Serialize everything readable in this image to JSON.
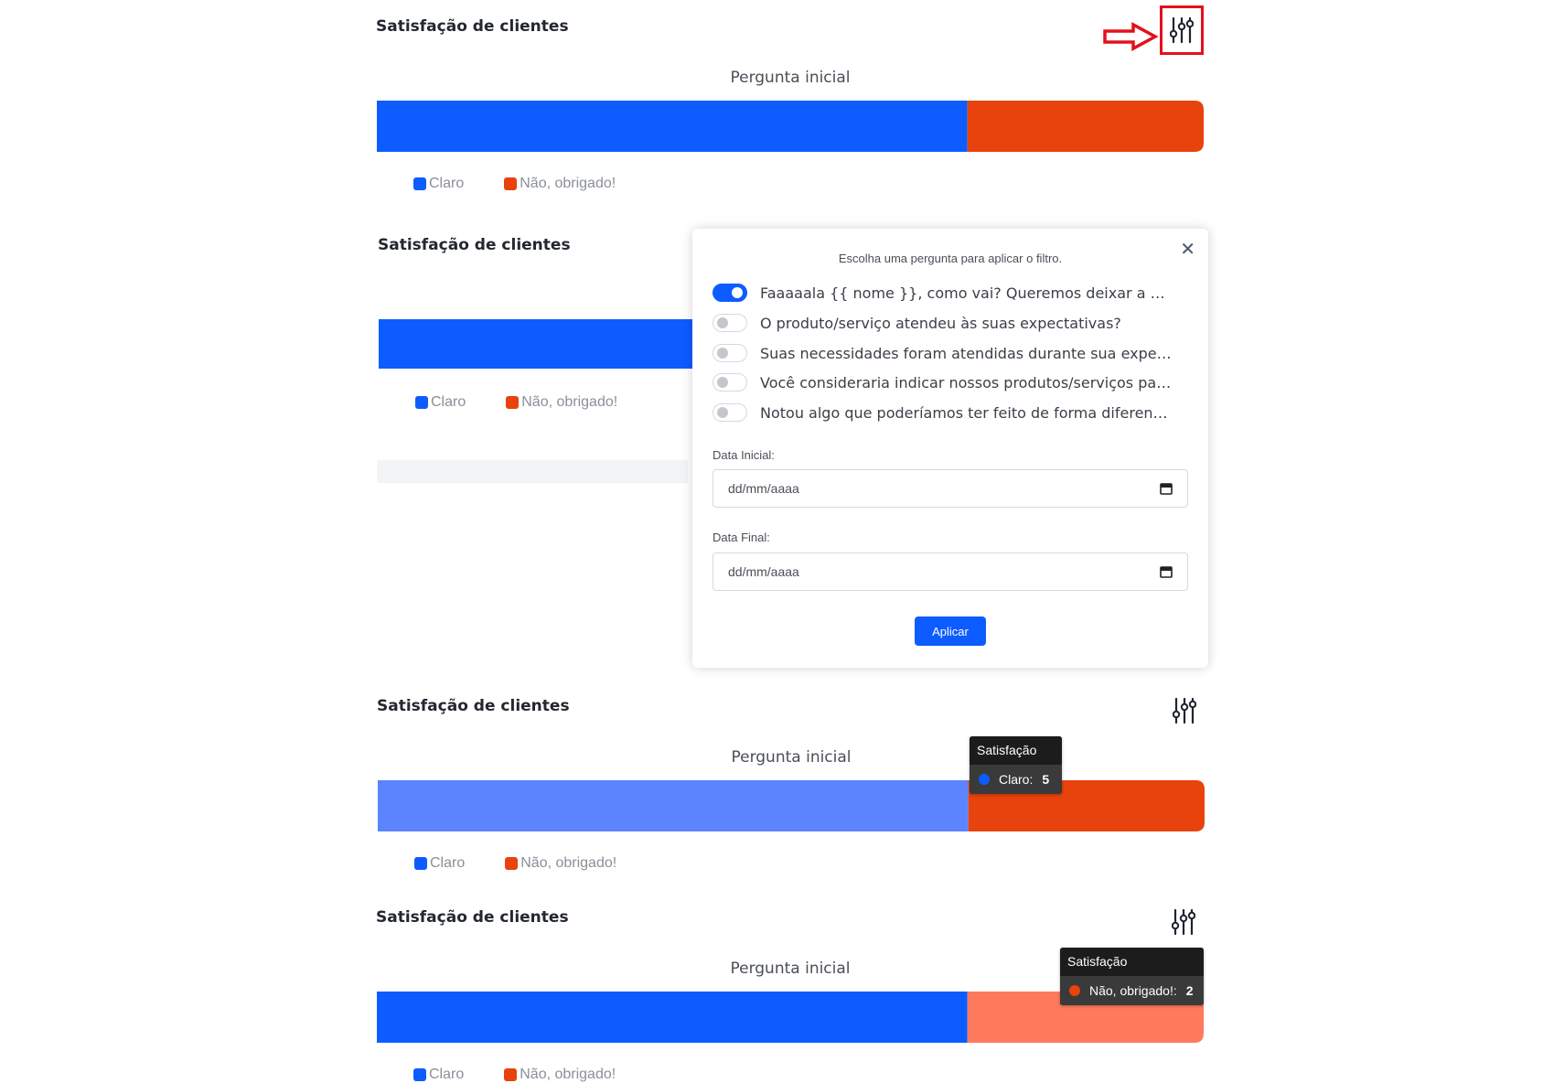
{
  "colors": {
    "claro": "#0d5cff",
    "nao": "#e8430c",
    "claro_hover": "#5c84ff",
    "nao_hover": "#ff7a5c",
    "highlight": "#e3101c"
  },
  "icons": {
    "filter": "sliders-icon",
    "close": "close-icon",
    "calendar": "calendar-icon",
    "arrow": "right-arrow-icon"
  },
  "panels": [
    {
      "title": "Satisfação de clientes",
      "subtitle": "Pergunta inicial"
    },
    {
      "title": "Satisfação de clientes",
      "subtitle": "Pergunta inicial"
    },
    {
      "title": "Satisfação de clientes",
      "subtitle": "Pergunta inicial"
    },
    {
      "title": "Satisfação de clientes",
      "subtitle": "Pergunta inicial"
    }
  ],
  "legend": {
    "claro": "Claro",
    "nao": "Não, obrigado!"
  },
  "chart_data": {
    "type": "bar",
    "orientation": "horizontal-stacked",
    "title": "Pergunta inicial",
    "series": [
      {
        "name": "Claro",
        "values": [
          5
        ]
      },
      {
        "name": "Não, obrigado!",
        "values": [
          2
        ]
      }
    ],
    "legend_position": "bottom-left"
  },
  "modal": {
    "instruction": "Escolha uma pergunta para aplicar o filtro.",
    "questions": [
      {
        "label": "Faaaaala {{ nome }}, como vai? Queremos deixar a nossa experiência ainda melhor",
        "on": true
      },
      {
        "label": "O produto/serviço atendeu às suas expectativas?",
        "on": false
      },
      {
        "label": "Suas necessidades foram atendidas durante sua experiência?",
        "on": false
      },
      {
        "label": "Você consideraria indicar nossos produtos/serviços para amigos?",
        "on": false
      },
      {
        "label": "Notou algo que poderíamos ter feito de forma diferente?",
        "on": false
      }
    ],
    "start_label": "Data Inicial:",
    "start_placeholder": "dd/mm/aaaa",
    "end_label": "Data Final:",
    "end_placeholder": "dd/mm/aaaa",
    "apply_label": "Aplicar"
  },
  "tooltips": [
    {
      "title": "Satisfação",
      "label": "Claro:",
      "value": "5"
    },
    {
      "title": "Satisfação",
      "label": "Não, obrigado!:",
      "value": "2"
    }
  ]
}
